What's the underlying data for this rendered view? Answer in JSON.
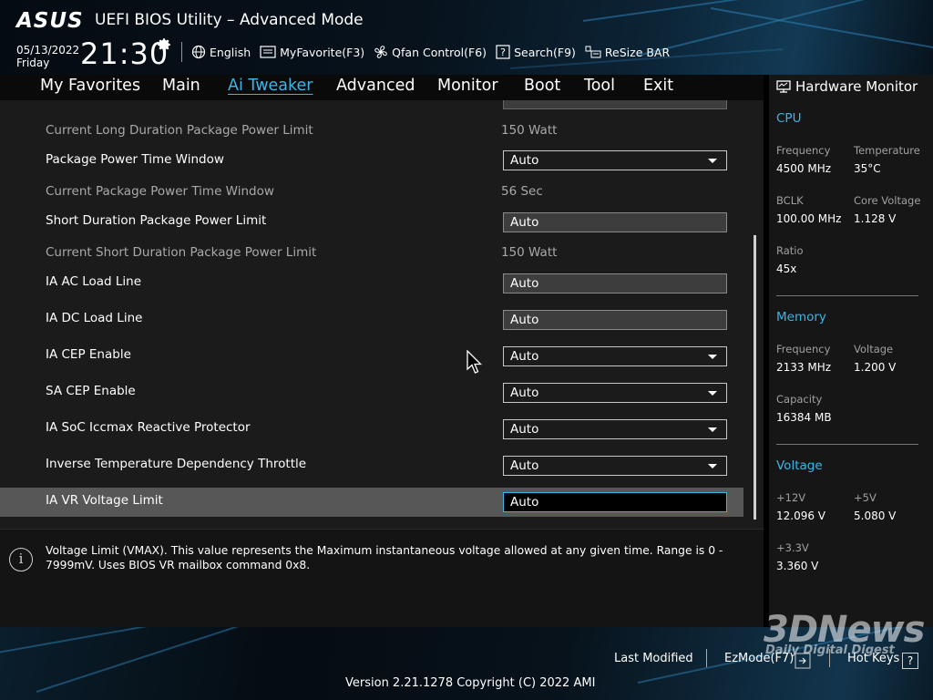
{
  "header": {
    "logo": "ASUS",
    "title": "UEFI BIOS Utility – Advanced Mode",
    "date": "05/13/2022",
    "day": "Friday",
    "time": "21:30",
    "tools": [
      {
        "label": "English",
        "icon": "globe-icon"
      },
      {
        "label": "MyFavorite(F3)",
        "icon": "favorite-icon"
      },
      {
        "label": "Qfan Control(F6)",
        "icon": "fan-icon"
      },
      {
        "label": "Search(F9)",
        "icon": "search-help-icon"
      },
      {
        "label": "ReSize BAR",
        "icon": "resize-bar-icon"
      }
    ]
  },
  "nav": {
    "tabs": [
      "My Favorites",
      "Main",
      "Ai Tweaker",
      "Advanced",
      "Monitor",
      "Boot",
      "Tool",
      "Exit"
    ],
    "active": "Ai Tweaker"
  },
  "settings": [
    {
      "label": "Current Long Duration Package Power Limit",
      "value": "150 Watt"
    },
    {
      "label": "Package Power Time Window",
      "value": "Auto"
    },
    {
      "label": "Current Package Power Time Window",
      "value": "56 Sec"
    },
    {
      "label": "Short Duration Package Power Limit",
      "value": "Auto"
    },
    {
      "label": "Current Short Duration Package Power Limit",
      "value": "150 Watt"
    },
    {
      "label": "IA AC Load Line",
      "value": "Auto"
    },
    {
      "label": "IA DC Load Line",
      "value": "Auto"
    },
    {
      "label": "IA CEP Enable",
      "value": "Auto"
    },
    {
      "label": "SA CEP Enable",
      "value": "Auto"
    },
    {
      "label": "IA SoC Iccmax Reactive Protector",
      "value": "Auto"
    },
    {
      "label": "Inverse Temperature Dependency Throttle",
      "value": "Auto"
    },
    {
      "label": "IA VR Voltage Limit",
      "value": "Auto"
    }
  ],
  "help": {
    "text": "Voltage Limit (VMAX). This value represents the Maximum instantaneous voltage allowed at any given time. Range is 0 - 7999mV. Uses BIOS VR mailbox command 0x8."
  },
  "hardware_monitor": {
    "title": "Hardware Monitor",
    "cpu": {
      "header": "CPU",
      "frequency_label": "Frequency",
      "frequency": "4500 MHz",
      "temperature_label": "Temperature",
      "temperature": "35°C",
      "bclk_label": "BCLK",
      "bclk": "100.00 MHz",
      "core_voltage_label": "Core Voltage",
      "core_voltage": "1.128 V",
      "ratio_label": "Ratio",
      "ratio": "45x"
    },
    "memory": {
      "header": "Memory",
      "frequency_label": "Frequency",
      "frequency": "2133 MHz",
      "voltage_label": "Voltage",
      "voltage": "1.200 V",
      "capacity_label": "Capacity",
      "capacity": "16384 MB"
    },
    "voltage": {
      "header": "Voltage",
      "v12_label": "+12V",
      "v12": "12.096 V",
      "v5_label": "+5V",
      "v5": "5.080 V",
      "v33_label": "+3.3V",
      "v33": "3.360 V"
    }
  },
  "footer": {
    "last_modified": "Last Modified",
    "ezmode": "EzMode(F7)",
    "hot_keys": "Hot Keys",
    "hot_keys_key": "?",
    "version": "Version 2.21.1278 Copyright (C) 2022 AMI"
  },
  "watermark": {
    "brand": "3DNews",
    "tagline": "Daily Digital Digest"
  },
  "colors": {
    "accent": "#39b6e8",
    "selected_row": "#575757",
    "panel": "#1b1b1b"
  }
}
